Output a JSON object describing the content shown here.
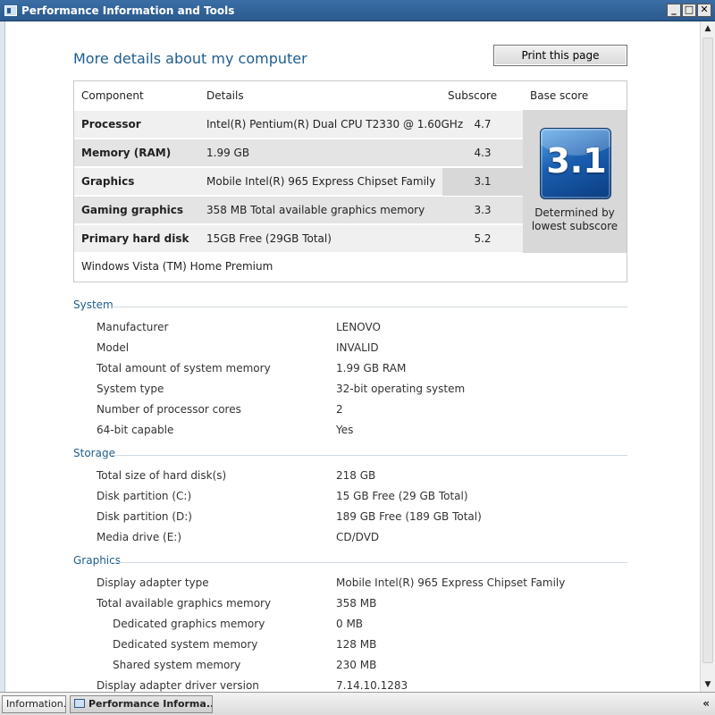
{
  "window": {
    "title": "Performance Information and Tools",
    "controls": {
      "minimize": "_",
      "maximize": "□",
      "close": "✕"
    }
  },
  "page": {
    "title": "More details about my computer",
    "print_label": "Print this page"
  },
  "score_table": {
    "headers": {
      "component": "Component",
      "details": "Details",
      "subscore": "Subscore",
      "base": "Base score"
    },
    "rows": [
      {
        "component": "Processor",
        "details": "Intel(R) Pentium(R) Dual CPU T2330 @ 1.60GHz",
        "subscore": "4.7"
      },
      {
        "component": "Memory (RAM)",
        "details": "1.99 GB",
        "subscore": "4.3"
      },
      {
        "component": "Graphics",
        "details": "Mobile Intel(R) 965 Express Chipset Family",
        "subscore": "3.1"
      },
      {
        "component": "Gaming graphics",
        "details": "358 MB Total available graphics memory",
        "subscore": "3.3"
      },
      {
        "component": "Primary hard disk",
        "details": "15GB Free (29GB Total)",
        "subscore": "5.2"
      }
    ],
    "base_score": "3.1",
    "base_caption": "Determined by lowest subscore",
    "os": "Windows Vista (TM) Home Premium"
  },
  "system": {
    "title": "System",
    "items": [
      {
        "label": "Manufacturer",
        "value": "LENOVO"
      },
      {
        "label": "Model",
        "value": "INVALID"
      },
      {
        "label": "Total amount of system memory",
        "value": "1.99 GB RAM"
      },
      {
        "label": "System type",
        "value": "32-bit operating system"
      },
      {
        "label": "Number of processor cores",
        "value": "2"
      },
      {
        "label": "64-bit capable",
        "value": "Yes"
      }
    ]
  },
  "storage": {
    "title": "Storage",
    "items": [
      {
        "label": "Total size of hard disk(s)",
        "value": "218 GB"
      },
      {
        "label": "Disk partition (C:)",
        "value": "15 GB Free (29 GB Total)"
      },
      {
        "label": "Disk partition (D:)",
        "value": "189 GB Free (189 GB Total)"
      },
      {
        "label": "Media drive (E:)",
        "value": "CD/DVD"
      }
    ]
  },
  "graphics": {
    "title": "Graphics",
    "items": [
      {
        "label": "Display adapter type",
        "value": "Mobile Intel(R) 965 Express Chipset Family"
      },
      {
        "label": "Total available graphics memory",
        "value": "358 MB"
      },
      {
        "label": "Dedicated graphics memory",
        "value": "0 MB"
      },
      {
        "label": "Dedicated system memory",
        "value": "128 MB"
      },
      {
        "label": "Shared system memory",
        "value": "230 MB"
      },
      {
        "label": "Display adapter driver version",
        "value": "7.14.10.1283"
      }
    ]
  },
  "taskbar": {
    "items": [
      {
        "label": "Information..."
      },
      {
        "label": "Performance Informa..."
      }
    ],
    "tray_arrow": "«"
  },
  "colors": {
    "title_blue": "#1f5d8f",
    "titlebar": "#2b5a8e"
  }
}
